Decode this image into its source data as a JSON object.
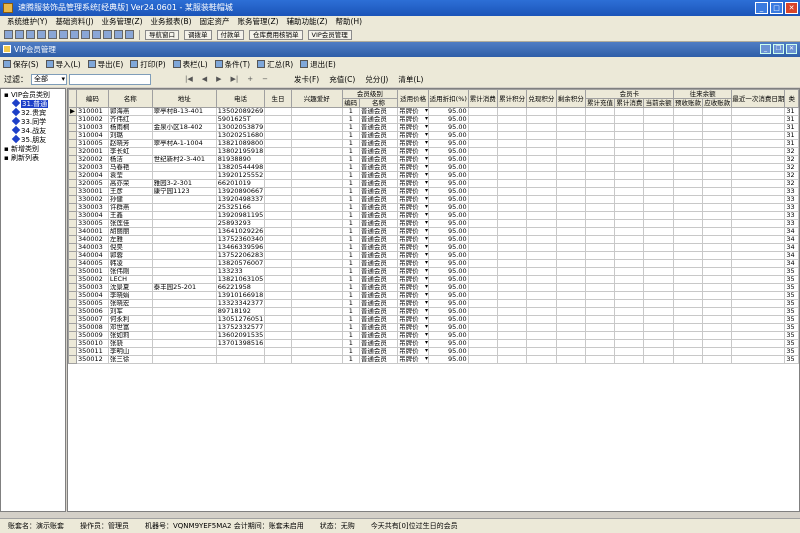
{
  "window": {
    "title": "速腾服装饰品管理系统[经典版] Ver24.0601 - 某服装鞋帽城"
  },
  "menu": [
    "系统维护(Y)",
    "基础资料(J)",
    "业务管理(Z)",
    "业务报表(B)",
    "固定资产",
    "账务管理(Z)",
    "辅助功能(Z)",
    "帮助(H)"
  ],
  "toolbar_nav": [
    "导航窗口",
    "调拨单",
    "付款单",
    "仓库费用核销单",
    "VIP会员管理"
  ],
  "mdi": {
    "title": "VIP会员管理"
  },
  "toolbar": [
    "保存(S)",
    "导入(L)",
    "导出(E)",
    "打印(P)",
    "表栏(L)",
    "条件(T)",
    "汇总(R)",
    "退出(E)"
  ],
  "filter": {
    "label": "过滤：",
    "value": "全部",
    "actions": [
      "发卡(F)",
      "充值(C)",
      "兑分(J)",
      "清单(L)"
    ]
  },
  "tree": {
    "root": "VIP会员类别",
    "children": [
      "31.普通",
      "32.贵宾",
      "33.同学",
      "34.战友",
      "35.朋友"
    ],
    "extra": [
      "新增类别",
      "刷新列表"
    ]
  },
  "grid": {
    "headers_top": {
      "level": "会员级别",
      "card": "会员卡",
      "balance": "往来余额"
    },
    "headers": [
      "编码",
      "名称",
      "地址",
      "电话",
      "生日",
      "兴趣爱好",
      "编码",
      "名称",
      "适用价格",
      "适用折扣(%)",
      "累计消费",
      "累计积分",
      "兑现积分",
      "剩余积分",
      "累计充值",
      "累计消费",
      "当前余额",
      "预收账款",
      "应收账款",
      "最近一次消费日期",
      "类"
    ],
    "rows": [
      [
        "310001",
        "郭海燕",
        "翠亭村B-13-401",
        "13502089269",
        "",
        "",
        "1",
        "普通会员",
        "吊牌价",
        "95.00",
        "",
        "",
        "",
        "",
        "",
        "",
        "",
        "",
        "",
        "",
        "31"
      ],
      [
        "310002",
        "齐伟红",
        "",
        "5901625T",
        "",
        "",
        "1",
        "普通会员",
        "吊牌价",
        "95.00",
        "",
        "",
        "",
        "",
        "",
        "",
        "",
        "",
        "",
        "",
        "31"
      ],
      [
        "310003",
        "杨雨桐",
        "金泉小区18-402",
        "13002053879",
        "",
        "",
        "1",
        "普通会员",
        "吊牌价",
        "95.00",
        "",
        "",
        "",
        "",
        "",
        "",
        "",
        "",
        "",
        "",
        "31"
      ],
      [
        "310004",
        "刘璐",
        "",
        "13020251680",
        "",
        "",
        "1",
        "普通会员",
        "吊牌价",
        "95.00",
        "",
        "",
        "",
        "",
        "",
        "",
        "",
        "",
        "",
        "",
        "31"
      ],
      [
        "310005",
        "赵晓芳",
        "翠亭村A-1-1004",
        "13821089800",
        "",
        "",
        "1",
        "普通会员",
        "吊牌价",
        "95.00",
        "",
        "",
        "",
        "",
        "",
        "",
        "",
        "",
        "",
        "",
        "31"
      ],
      [
        "320001",
        "李长虹",
        "",
        "13802195918",
        "",
        "",
        "1",
        "普通会员",
        "吊牌价",
        "95.00",
        "",
        "",
        "",
        "",
        "",
        "",
        "",
        "",
        "",
        "",
        "32"
      ],
      [
        "320002",
        "杨洁",
        "世纪新村2-3-401",
        "81938890",
        "",
        "",
        "1",
        "普通会员",
        "吊牌价",
        "95.00",
        "",
        "",
        "",
        "",
        "",
        "",
        "",
        "",
        "",
        "",
        "32"
      ],
      [
        "320003",
        "马春艳",
        "",
        "13820544498",
        "",
        "",
        "1",
        "普通会员",
        "吊牌价",
        "95.00",
        "",
        "",
        "",
        "",
        "",
        "",
        "",
        "",
        "",
        "",
        "32"
      ],
      [
        "320004",
        "袁莹",
        "",
        "13920125552",
        "",
        "",
        "1",
        "普通会员",
        "吊牌价",
        "95.00",
        "",
        "",
        "",
        "",
        "",
        "",
        "",
        "",
        "",
        "",
        "32"
      ],
      [
        "320005",
        "高亦荣",
        "雅园3-2-301",
        "66201019",
        "",
        "",
        "1",
        "普通会员",
        "吊牌价",
        "95.00",
        "",
        "",
        "",
        "",
        "",
        "",
        "",
        "",
        "",
        "",
        "32"
      ],
      [
        "330001",
        "王彦",
        "康宁园1123",
        "13920890667",
        "",
        "",
        "1",
        "普通会员",
        "吊牌价",
        "95.00",
        "",
        "",
        "",
        "",
        "",
        "",
        "",
        "",
        "",
        "",
        "33"
      ],
      [
        "330002",
        "孙健",
        "",
        "13920498337",
        "",
        "",
        "1",
        "普通会员",
        "吊牌价",
        "95.00",
        "",
        "",
        "",
        "",
        "",
        "",
        "",
        "",
        "",
        "",
        "33"
      ],
      [
        "330003",
        "许群燕",
        "",
        "25325166",
        "",
        "",
        "1",
        "普通会员",
        "吊牌价",
        "95.00",
        "",
        "",
        "",
        "",
        "",
        "",
        "",
        "",
        "",
        "",
        "33"
      ],
      [
        "330004",
        "王鑫",
        "",
        "13920981195",
        "",
        "",
        "1",
        "普通会员",
        "吊牌价",
        "95.00",
        "",
        "",
        "",
        "",
        "",
        "",
        "",
        "",
        "",
        "",
        "33"
      ],
      [
        "330005",
        "张莲佳",
        "",
        "25893293",
        "",
        "",
        "1",
        "普通会员",
        "吊牌价",
        "95.00",
        "",
        "",
        "",
        "",
        "",
        "",
        "",
        "",
        "",
        "",
        "33"
      ],
      [
        "340001",
        "胡丽丽",
        "",
        "13641029226",
        "",
        "",
        "1",
        "普通会员",
        "吊牌价",
        "95.00",
        "",
        "",
        "",
        "",
        "",
        "",
        "",
        "",
        "",
        "",
        "34"
      ],
      [
        "340002",
        "左雅",
        "",
        "13752360340",
        "",
        "",
        "1",
        "普通会员",
        "吊牌价",
        "95.00",
        "",
        "",
        "",
        "",
        "",
        "",
        "",
        "",
        "",
        "",
        "34"
      ],
      [
        "340003",
        "倪昊",
        "",
        "13466339596",
        "",
        "",
        "1",
        "普通会员",
        "吊牌价",
        "95.00",
        "",
        "",
        "",
        "",
        "",
        "",
        "",
        "",
        "",
        "",
        "34"
      ],
      [
        "340004",
        "郭蓉",
        "",
        "13752206283",
        "",
        "",
        "1",
        "普通会员",
        "吊牌价",
        "95.00",
        "",
        "",
        "",
        "",
        "",
        "",
        "",
        "",
        "",
        "",
        "34"
      ],
      [
        "340005",
        "韩凌",
        "",
        "13820576007",
        "",
        "",
        "1",
        "普通会员",
        "吊牌价",
        "95.00",
        "",
        "",
        "",
        "",
        "",
        "",
        "",
        "",
        "",
        "",
        "34"
      ],
      [
        "350001",
        "张伟刚",
        "",
        "133233",
        "",
        "",
        "1",
        "普通会员",
        "吊牌价",
        "95.00",
        "",
        "",
        "",
        "",
        "",
        "",
        "",
        "",
        "",
        "",
        "35"
      ],
      [
        "350002",
        "LECH",
        "",
        "13821063105",
        "",
        "",
        "1",
        "普通会员",
        "吊牌价",
        "95.00",
        "",
        "",
        "",
        "",
        "",
        "",
        "",
        "",
        "",
        "",
        "35"
      ],
      [
        "350003",
        "沈景夏",
        "泰丰园25-201",
        "66221958",
        "",
        "",
        "1",
        "普通会员",
        "吊牌价",
        "95.00",
        "",
        "",
        "",
        "",
        "",
        "",
        "",
        "",
        "",
        "",
        "35"
      ],
      [
        "350004",
        "李晓娟",
        "",
        "13910166918",
        "",
        "",
        "1",
        "普通会员",
        "吊牌价",
        "95.00",
        "",
        "",
        "",
        "",
        "",
        "",
        "",
        "",
        "",
        "",
        "35"
      ],
      [
        "350005",
        "张晓宏",
        "",
        "13323342377",
        "",
        "",
        "1",
        "普通会员",
        "吊牌价",
        "95.00",
        "",
        "",
        "",
        "",
        "",
        "",
        "",
        "",
        "",
        "",
        "35"
      ],
      [
        "350006",
        "刘军",
        "",
        "89718192",
        "",
        "",
        "1",
        "普通会员",
        "吊牌价",
        "95.00",
        "",
        "",
        "",
        "",
        "",
        "",
        "",
        "",
        "",
        "",
        "35"
      ],
      [
        "350007",
        "何永利",
        "",
        "13051276051",
        "",
        "",
        "1",
        "普通会员",
        "吊牌价",
        "95.00",
        "",
        "",
        "",
        "",
        "",
        "",
        "",
        "",
        "",
        "",
        "35"
      ],
      [
        "350008",
        "邓世富",
        "",
        "13752332577",
        "",
        "",
        "1",
        "普通会员",
        "吊牌价",
        "95.00",
        "",
        "",
        "",
        "",
        "",
        "",
        "",
        "",
        "",
        "",
        "35"
      ],
      [
        "350009",
        "张如莉",
        "",
        "13602091535",
        "",
        "",
        "1",
        "普通会员",
        "吊牌价",
        "95.00",
        "",
        "",
        "",
        "",
        "",
        "",
        "",
        "",
        "",
        "",
        "35"
      ],
      [
        "350010",
        "张骁",
        "",
        "13701398516",
        "",
        "",
        "1",
        "普通会员",
        "吊牌价",
        "95.00",
        "",
        "",
        "",
        "",
        "",
        "",
        "",
        "",
        "",
        "",
        "35"
      ],
      [
        "350011",
        "李明山",
        "",
        "",
        "",
        "",
        "1",
        "普通会员",
        "吊牌价",
        "95.00",
        "",
        "",
        "",
        "",
        "",
        "",
        "",
        "",
        "",
        "",
        "35"
      ],
      [
        "350012",
        "张三徐",
        "",
        "",
        "",
        "",
        "1",
        "普通会员",
        "吊牌价",
        "95.00",
        "",
        "",
        "",
        "",
        "",
        "",
        "",
        "",
        "",
        "",
        "35"
      ]
    ]
  },
  "status": [
    "账套名：演示账套",
    "操作员：管理员",
    "机器号：VQNM9YEF5MA2 会计期间：账套未启用",
    "状态：无购",
    "今天共有[0]位过生日的会员"
  ]
}
